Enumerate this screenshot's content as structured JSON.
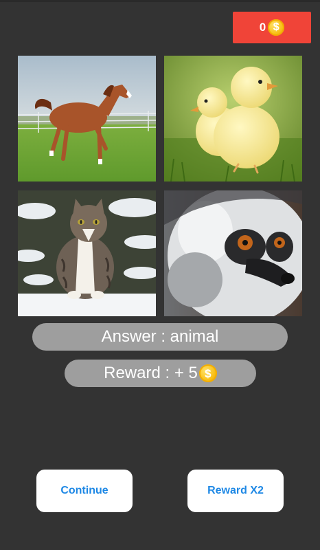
{
  "header": {
    "coin_count": "0",
    "coin_symbol": "$"
  },
  "tiles": [
    {
      "name": "horse"
    },
    {
      "name": "chicks"
    },
    {
      "name": "cat"
    },
    {
      "name": "lemur"
    }
  ],
  "answer": {
    "text": "Answer : animal"
  },
  "reward": {
    "text": "Reward : + 5",
    "coin_symbol": "$"
  },
  "buttons": {
    "continue_label": "Continue",
    "reward_x2_label": "Reward X2"
  },
  "colors": {
    "background": "#333333",
    "coin_badge": "#f04438",
    "pill": "#9e9e9e",
    "button_text": "#1e88e5",
    "coin": "#f9c21b"
  }
}
